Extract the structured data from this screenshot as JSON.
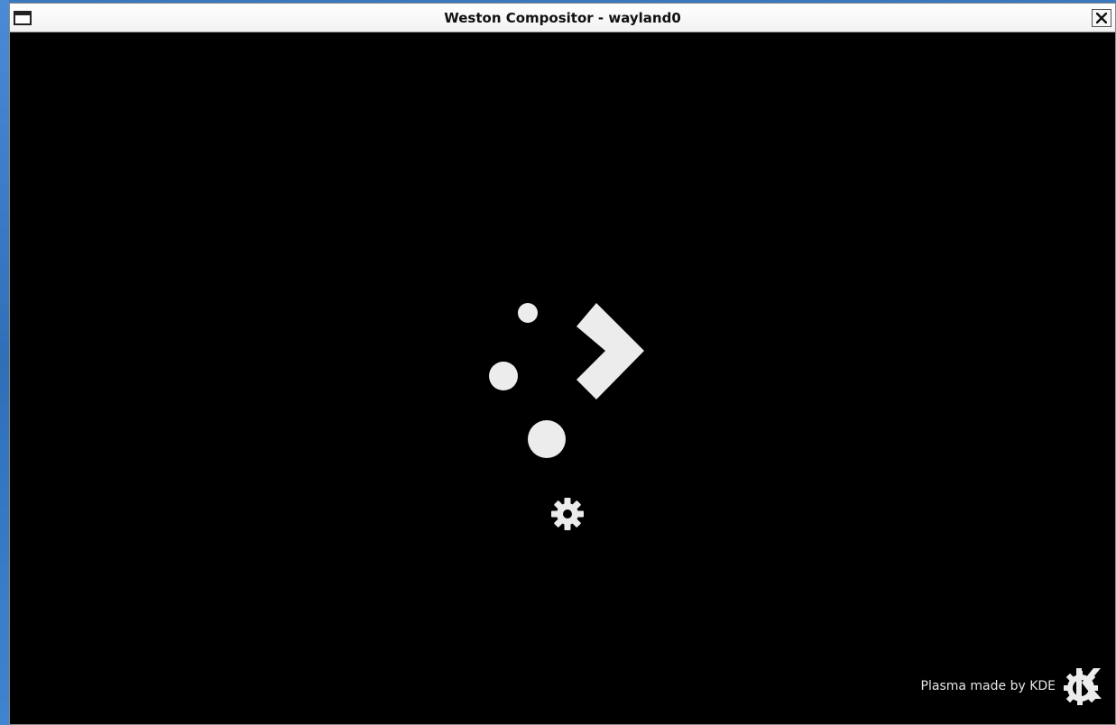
{
  "window": {
    "title": "Weston Compositor - wayland0",
    "close_label": "close"
  },
  "splash": {
    "logo_icon": "plasma-logo-icon",
    "loading_icon": "gear-icon",
    "footer_text": "Plasma made by KDE",
    "footer_icon": "kde-logo-icon"
  },
  "colors": {
    "background": "#000000",
    "foreground": "#ececec",
    "titlebar": "#f2f2f2",
    "desktop": "#3a78c0"
  }
}
